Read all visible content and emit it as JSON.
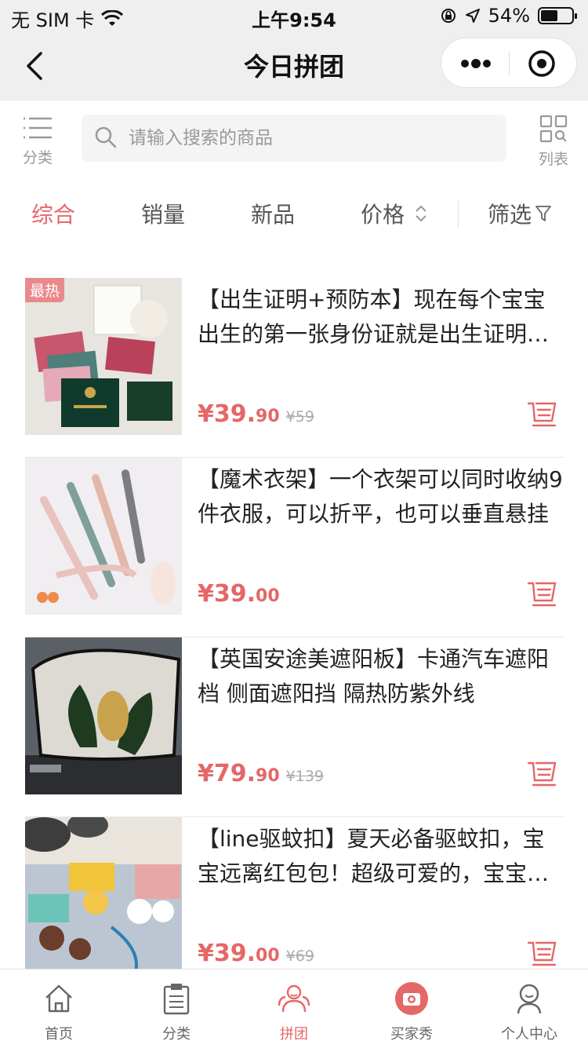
{
  "status_bar": {
    "carrier": "无 SIM 卡",
    "time": "上午9:54",
    "battery": "54%",
    "battery_level": 0.54
  },
  "nav": {
    "title": "今日拼团"
  },
  "search": {
    "category_label": "分类",
    "placeholder": "请输入搜索的商品",
    "list_label": "列表"
  },
  "sort_tabs": [
    {
      "label": "综合",
      "active": true
    },
    {
      "label": "销量"
    },
    {
      "label": "新品"
    },
    {
      "label": "价格"
    },
    {
      "label": "筛选"
    }
  ],
  "products": [
    {
      "badge": "最热",
      "title": "【出生证明+预防本】现在每个宝宝出生的第一张身份证就是出生证明了，这个出生证明保护套",
      "price_int": "¥39.",
      "price_dec": "90",
      "old_price": "¥59"
    },
    {
      "title": "【魔术衣架】一个衣架可以同时收纳9件衣服，可以折平，也可以垂直悬挂",
      "price_int": "¥39.",
      "price_dec": "00",
      "old_price": ""
    },
    {
      "title": "【英国安途美遮阳板】卡通汽车遮阳档 侧面遮阳挡 隔热防紫外线",
      "price_int": "¥79.",
      "price_dec": "90",
      "old_price": "¥139"
    },
    {
      "title": "【line驱蚊扣】夏天必备驱蚊扣，宝宝远离红包包！超级可爱的，宝宝很喜欢",
      "price_int": "¥39.",
      "price_dec": "00",
      "old_price": "¥69"
    }
  ],
  "tab_bar": [
    {
      "label": "首页",
      "icon": "home-icon"
    },
    {
      "label": "分类",
      "icon": "clipboard-icon"
    },
    {
      "label": "拼团",
      "icon": "group-icon",
      "active": true
    },
    {
      "label": "买家秀",
      "icon": "camera-icon"
    },
    {
      "label": "个人中心",
      "icon": "person-icon"
    }
  ],
  "colors": {
    "accent": "#e56767",
    "nav_bg": "#efefef"
  }
}
